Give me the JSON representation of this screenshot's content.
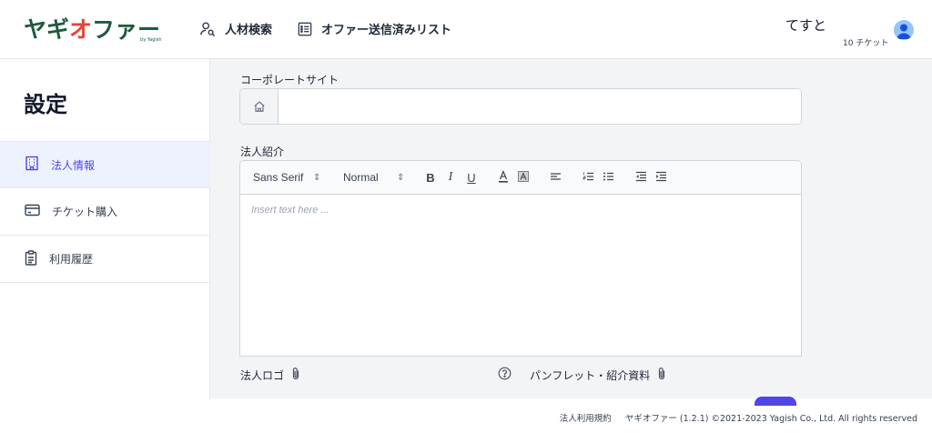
{
  "header": {
    "logo": {
      "part1": "ヤギ",
      "part2": "オ",
      "part3": "ファー",
      "sub": "by Yagish"
    },
    "nav": [
      {
        "label": "人材検索",
        "icon": "person-search-icon"
      },
      {
        "label": "オファー送信済みリスト",
        "icon": "list-icon"
      }
    ],
    "user_name": "てすと",
    "tickets": "10 チケット"
  },
  "sidebar": {
    "title": "設定",
    "items": [
      {
        "label": "法人情報",
        "icon": "building-icon",
        "active": true
      },
      {
        "label": "チケット購入",
        "icon": "credit-card-icon",
        "active": false
      },
      {
        "label": "利用履歴",
        "icon": "clipboard-icon",
        "active": false
      }
    ]
  },
  "main": {
    "corporate_site": {
      "label": "コーポレートサイト",
      "value": "",
      "icon": "home-icon"
    },
    "intro": {
      "label": "法人紹介",
      "font_select": "Sans Serif",
      "size_select": "Normal",
      "placeholder": "Insert text here ..."
    },
    "logo_upload": {
      "label": "法人ロゴ",
      "icon": "paperclip-icon"
    },
    "pamphlet_upload": {
      "label": "パンフレット・紹介資料",
      "icon": "paperclip-icon",
      "help_icon": "question-icon"
    }
  },
  "footer": {
    "terms": "法人利用規約",
    "copyright": "ヤギオファー (1.2.1) ©2021-2023 Yagish Co., Ltd. All rights reserved"
  },
  "colors": {
    "accent": "#4f46e5",
    "logo_green": "#1e5b3c",
    "logo_red": "#e2453a"
  }
}
